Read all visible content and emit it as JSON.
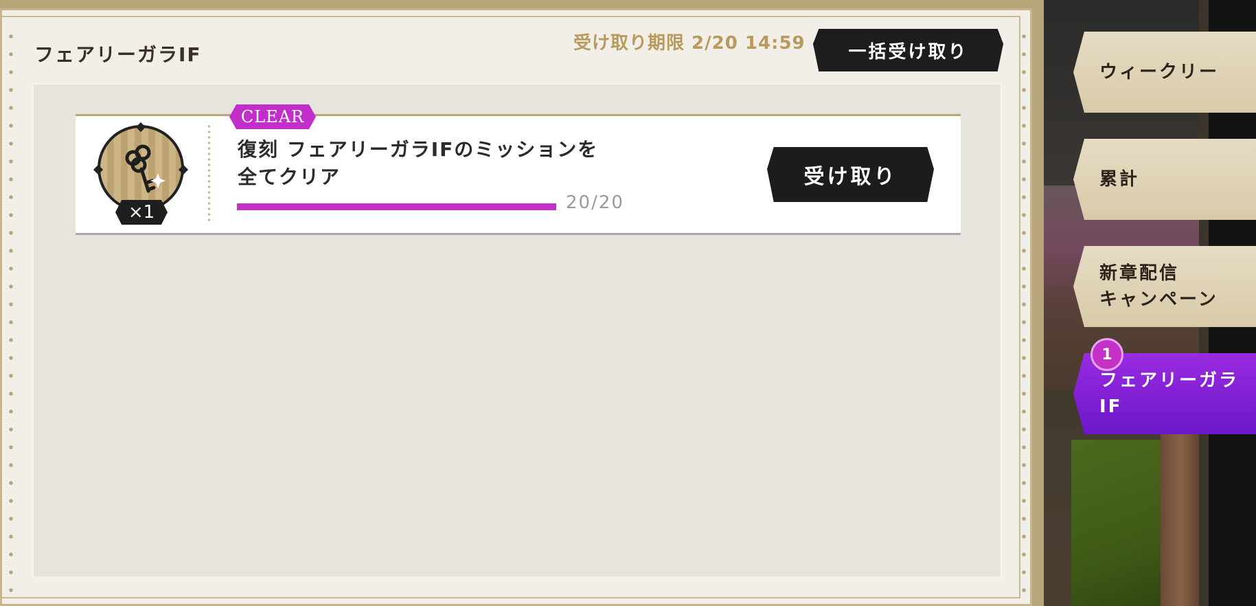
{
  "panel": {
    "title": "フェアリーガラIF",
    "deadline": "受け取り期限 2/20 14:59",
    "bulk_claim_label": "一括受け取り"
  },
  "mission": {
    "badge": "CLEAR",
    "description": "復刻 フェアリーガラIFのミッションを\n全てクリア",
    "reward_icon": "key-icon",
    "reward_quantity": "×1",
    "progress_current": 20,
    "progress_total": 20,
    "progress_text": "20/20",
    "claim_label": "受け取り"
  },
  "tabs": [
    {
      "label": "ウィークリー",
      "active": false
    },
    {
      "label": "累計",
      "active": false
    },
    {
      "label": "新章配信\nキャンペーン",
      "active": false
    },
    {
      "label": "フェアリーガラIF",
      "active": true,
      "badge": "1"
    }
  ],
  "colors": {
    "accent_purple": "#c530c6",
    "active_tab": "#7a1fd6",
    "gold": "#b89a5c"
  }
}
